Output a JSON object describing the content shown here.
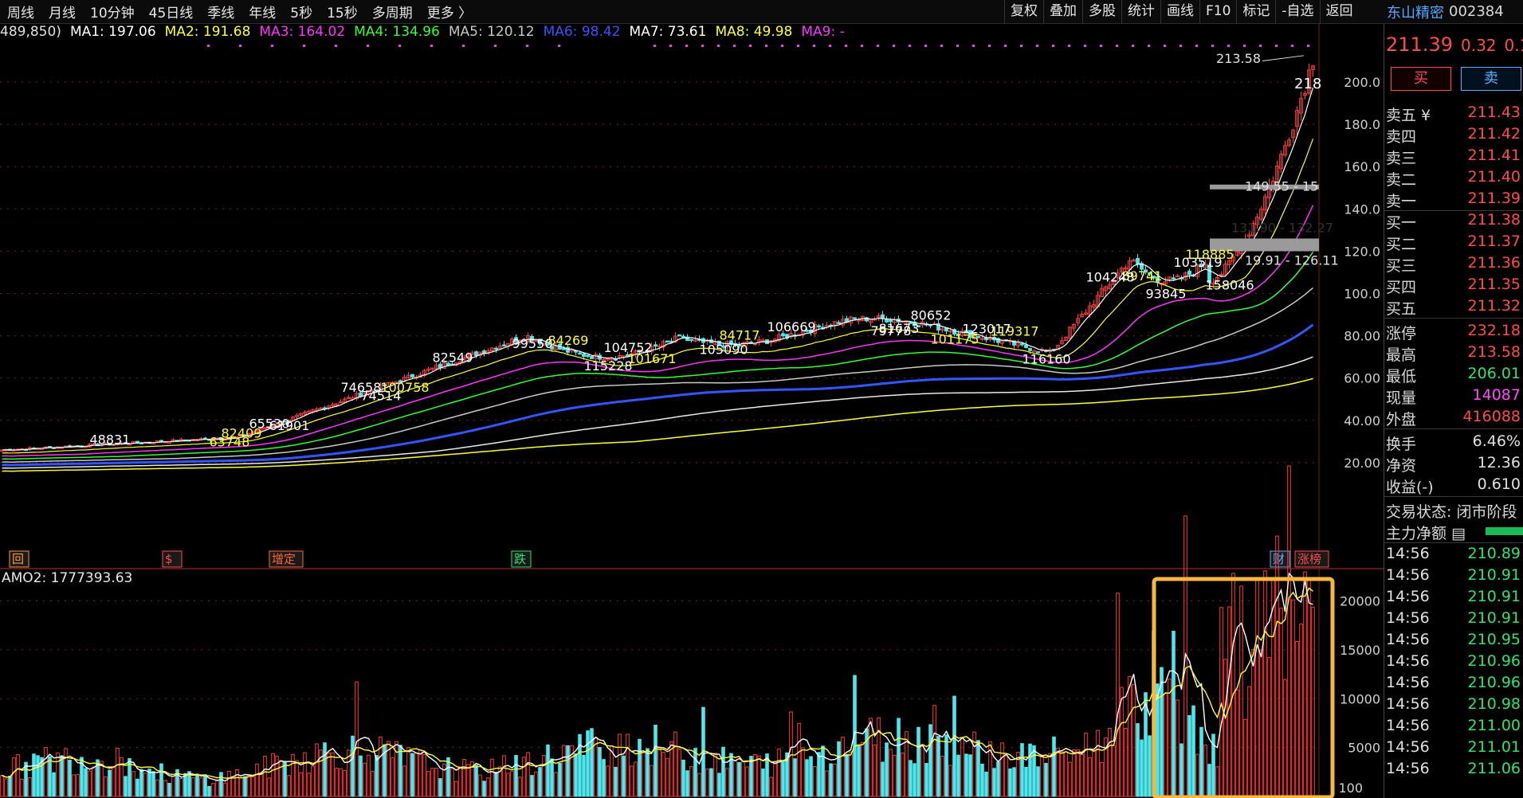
{
  "nav_tabs": [
    "周线",
    "月线",
    "10分钟",
    "45日线",
    "季线",
    "年线",
    "5秒",
    "15秒",
    "多周期",
    "更多 〉"
  ],
  "tools": [
    "复权",
    "叠加",
    "多股",
    "统计",
    "画线",
    "F10",
    "标记",
    "-自选",
    "返回"
  ],
  "stock": {
    "name": "东山精密",
    "code": "002384"
  },
  "legend": [
    {
      "label": "489,850)",
      "color": "#e0e0e0"
    },
    {
      "label": "MA1: 197.06",
      "color": "#ffffff"
    },
    {
      "label": "MA2: 191.68",
      "color": "#ffff33"
    },
    {
      "label": "MA3: 164.02",
      "color": "#ff33ff"
    },
    {
      "label": "MA4: 134.96",
      "color": "#33ff33"
    },
    {
      "label": "MA5: 120.12",
      "color": "#c8c8c8"
    },
    {
      "label": "MA6: 98.42",
      "color": "#3355ff"
    },
    {
      "label": "MA7: 73.61",
      "color": "#ffffff"
    },
    {
      "label": "MA8: 49.98",
      "color": "#ffff33"
    },
    {
      "label": "MA9: -",
      "color": "#ff33ff"
    }
  ],
  "price_axis": [
    "200.0",
    "180.0",
    "160.0",
    "140.0",
    "120.0",
    "100.0",
    "80.00",
    "60.00",
    "40.00",
    "20.00"
  ],
  "volume_axis": [
    "20000",
    "15000",
    "10000",
    "5000"
  ],
  "volume_axis_unit": "100",
  "chart_labels": {
    "high": "213.58",
    "last": "218",
    "band_upper": "149.55 - 15",
    "band_lower": "131.90 - 132.27",
    "band_bottom": "19.91 - 126.11",
    "price_notes": [
      "158046",
      "118885",
      "93845",
      "103519",
      "89741",
      "104248",
      "81673",
      "119317",
      "116160",
      "123017",
      "101175",
      "80652",
      "79778",
      "84717",
      "105090",
      "106669",
      "101671",
      "104752",
      "115228",
      "84269",
      "99550",
      "82549",
      "100758",
      "74658",
      "74514",
      "82409",
      "61901",
      "65530",
      "63748",
      "48831"
    ]
  },
  "event_tags": [
    {
      "text": "回",
      "color": "#ff9933"
    },
    {
      "text": "$",
      "color": "#ff4b4b"
    },
    {
      "text": "增定",
      "color": "#ff6633"
    },
    {
      "text": "跌",
      "color": "#2ee36f"
    },
    {
      "text": "财",
      "color": "#5ab0ff"
    },
    {
      "text": "涨榜",
      "color": "#ff4b4b"
    }
  ],
  "amo_label": "AMO2: 1777393.63",
  "quote": {
    "price": "211.39",
    "change": "0.32",
    "change_pct": "0.1",
    "buy_label": "买",
    "sell_label": "卖"
  },
  "order_book": {
    "asks": [
      {
        "label": "卖五 ¥",
        "price": "211.43"
      },
      {
        "label": "卖四",
        "price": "211.42"
      },
      {
        "label": "卖三",
        "price": "211.41"
      },
      {
        "label": "卖二",
        "price": "211.40"
      },
      {
        "label": "卖一",
        "price": "211.39"
      }
    ],
    "bids": [
      {
        "label": "买一",
        "price": "211.38"
      },
      {
        "label": "买二",
        "price": "211.37"
      },
      {
        "label": "买三",
        "price": "211.36"
      },
      {
        "label": "买四",
        "price": "211.35"
      },
      {
        "label": "买五",
        "price": "211.32"
      }
    ]
  },
  "stats": [
    {
      "label": "涨停",
      "value": "232.18",
      "color": "#ff4b4b"
    },
    {
      "label": "最高",
      "value": "213.58",
      "color": "#ff4b4b"
    },
    {
      "label": "最低",
      "value": "206.01",
      "color": "#2ee36f"
    },
    {
      "label": "现量",
      "value": "14087",
      "color": "#ff4bff"
    },
    {
      "label": "外盘",
      "value": "416088",
      "color": "#ff4b4b"
    }
  ],
  "stats2": [
    {
      "label": "换手",
      "value": "6.46%",
      "color": "#e0e0e0"
    },
    {
      "label": "净资",
      "value": "12.36",
      "color": "#e0e0e0"
    },
    {
      "label": "收益(-)",
      "value": "0.610",
      "color": "#e0e0e0"
    }
  ],
  "trade_status": "交易状态: 闭市阶段",
  "main_flow_label": "主力净额",
  "ticks": [
    {
      "time": "14:56",
      "price": "210.89"
    },
    {
      "time": "14:56",
      "price": "210.91"
    },
    {
      "time": "14:56",
      "price": "210.91"
    },
    {
      "time": "14:56",
      "price": "210.91"
    },
    {
      "time": "14:56",
      "price": "210.95"
    },
    {
      "time": "14:56",
      "price": "210.96"
    },
    {
      "time": "14:56",
      "price": "210.96"
    },
    {
      "time": "14:56",
      "price": "210.98"
    },
    {
      "time": "14:56",
      "price": "211.00"
    },
    {
      "time": "14:56",
      "price": "211.01"
    },
    {
      "time": "14:56",
      "price": "211.06"
    }
  ],
  "colors": {
    "up": "#ff3b3b",
    "down": "#4fe6ec",
    "highlight": "#f6b73c"
  }
}
